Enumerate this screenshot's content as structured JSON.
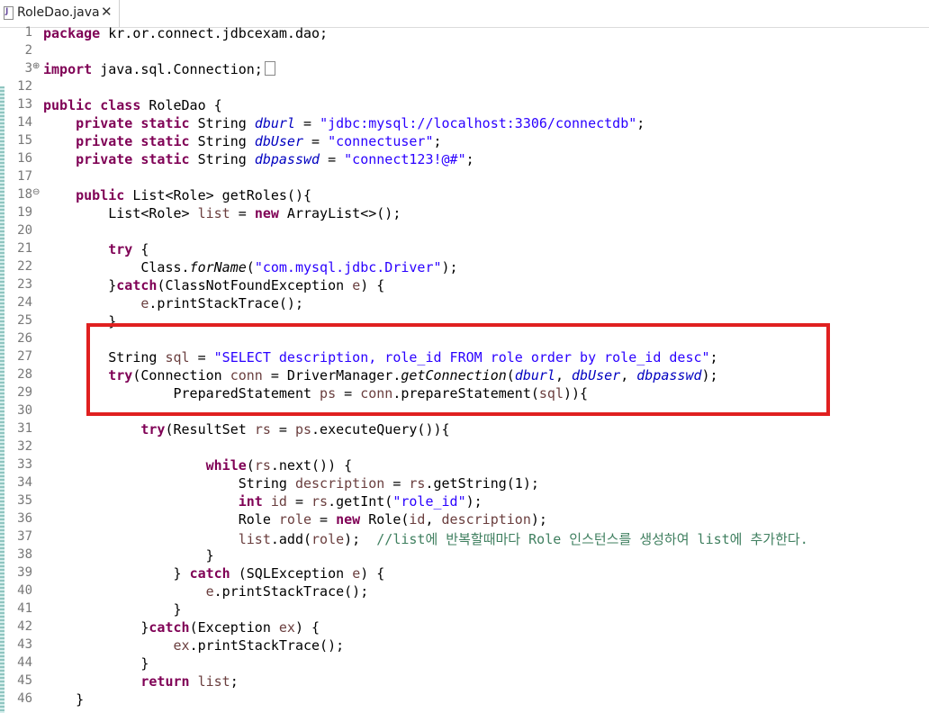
{
  "tab": {
    "title": "RoleDao.java",
    "close": "✕",
    "icon": "java-file-icon"
  },
  "fold_markers": {
    "collapsed": "⊕",
    "expanded": "⊖"
  },
  "lines": {
    "l1": {
      "no": "1",
      "t": [
        "package",
        " kr.or.connect.jdbcexam.dao;"
      ]
    },
    "l2": {
      "no": "2"
    },
    "l3": {
      "no": "3",
      "t": [
        "import",
        " java.sql.Connection;"
      ]
    },
    "l12": {
      "no": "12"
    },
    "l13": {
      "no": "13",
      "t": [
        "public",
        " ",
        "class",
        " RoleDao {"
      ]
    },
    "l14": {
      "no": "14",
      "t": [
        "    ",
        "private",
        " ",
        "static",
        " String ",
        "dburl",
        " = ",
        "\"jdbc:mysql://localhost:3306/connectdb\"",
        ";"
      ]
    },
    "l15": {
      "no": "15",
      "t": [
        "    ",
        "private",
        " ",
        "static",
        " String ",
        "dbUser",
        " = ",
        "\"connectuser\"",
        ";"
      ]
    },
    "l16": {
      "no": "16",
      "t": [
        "    ",
        "private",
        " ",
        "static",
        " String ",
        "dbpasswd",
        " = ",
        "\"connect123!@#\"",
        ";"
      ]
    },
    "l17": {
      "no": "17"
    },
    "l18": {
      "no": "18",
      "t": [
        "    ",
        "public",
        " List<Role> getRoles(){"
      ]
    },
    "l19": {
      "no": "19",
      "t": [
        "        List<Role> ",
        "list",
        " = ",
        "new",
        " ArrayList<>();"
      ]
    },
    "l20": {
      "no": "20"
    },
    "l21": {
      "no": "21",
      "t": [
        "        ",
        "try",
        " {"
      ]
    },
    "l22": {
      "no": "22",
      "t": [
        "            Class.",
        "forName",
        "(",
        "\"com.mysql.jdbc.Driver\"",
        ");"
      ]
    },
    "l23": {
      "no": "23",
      "t": [
        "        }",
        "catch",
        "(ClassNotFoundException ",
        "e",
        ") {"
      ]
    },
    "l24": {
      "no": "24",
      "t": [
        "            ",
        "e",
        ".printStackTrace();"
      ]
    },
    "l25": {
      "no": "25",
      "t": [
        "        }"
      ]
    },
    "l26": {
      "no": "26"
    },
    "l27": {
      "no": "27",
      "t": [
        "        String ",
        "sql",
        " = ",
        "\"SELECT description, role_id FROM role order by role_id desc\"",
        ";"
      ]
    },
    "l28": {
      "no": "28",
      "t": [
        "        ",
        "try",
        "(Connection ",
        "conn",
        " = DriverManager.",
        "getConnection",
        "(",
        "dburl",
        ", ",
        "dbUser",
        ", ",
        "dbpasswd",
        ");"
      ]
    },
    "l29": {
      "no": "29",
      "t": [
        "                PreparedStatement ",
        "ps",
        " = ",
        "conn",
        ".prepareStatement(",
        "sql",
        ")){"
      ]
    },
    "l30": {
      "no": "30"
    },
    "l31": {
      "no": "31",
      "t": [
        "            ",
        "try",
        "(ResultSet ",
        "rs",
        " = ",
        "ps",
        ".executeQuery()){"
      ]
    },
    "l32": {
      "no": "32"
    },
    "l33": {
      "no": "33",
      "t": [
        "                    ",
        "while",
        "(",
        "rs",
        ".next()) {"
      ]
    },
    "l34": {
      "no": "34",
      "t": [
        "                        String ",
        "description",
        " = ",
        "rs",
        ".getString(1);"
      ]
    },
    "l35": {
      "no": "35",
      "t": [
        "                        ",
        "int",
        " ",
        "id",
        " = ",
        "rs",
        ".getInt(",
        "\"role_id\"",
        ");"
      ]
    },
    "l36": {
      "no": "36",
      "t": [
        "                        Role ",
        "role",
        " = ",
        "new",
        " Role(",
        "id",
        ", ",
        "description",
        ");"
      ]
    },
    "l37": {
      "no": "37",
      "t": [
        "                        ",
        "list",
        ".add(",
        "role",
        ");  ",
        "//list에 반복할때마다 Role 인스턴스를 생성하여 list에 추가한다."
      ]
    },
    "l38": {
      "no": "38",
      "t": [
        "                    }"
      ]
    },
    "l39": {
      "no": "39",
      "t": [
        "                } ",
        "catch",
        " (SQLException ",
        "e",
        ") {"
      ]
    },
    "l40": {
      "no": "40",
      "t": [
        "                    ",
        "e",
        ".printStackTrace();"
      ]
    },
    "l41": {
      "no": "41",
      "t": [
        "                }"
      ]
    },
    "l42": {
      "no": "42",
      "t": [
        "            }",
        "catch",
        "(Exception ",
        "ex",
        ") {"
      ]
    },
    "l43": {
      "no": "43",
      "t": [
        "                ",
        "ex",
        ".printStackTrace();"
      ]
    },
    "l44": {
      "no": "44",
      "t": [
        "            }"
      ]
    },
    "l45": {
      "no": "45",
      "t": [
        "            ",
        "return",
        " ",
        "list",
        ";"
      ]
    },
    "l46": {
      "no": "46",
      "t": [
        "    }"
      ]
    }
  },
  "colors": {
    "keyword": "#7f0055",
    "string": "#2a00ff",
    "field": "#0000c0",
    "local_variable": "#6a3e3e",
    "comment": "#3f7f5f",
    "highlight_box": "#e02020"
  }
}
